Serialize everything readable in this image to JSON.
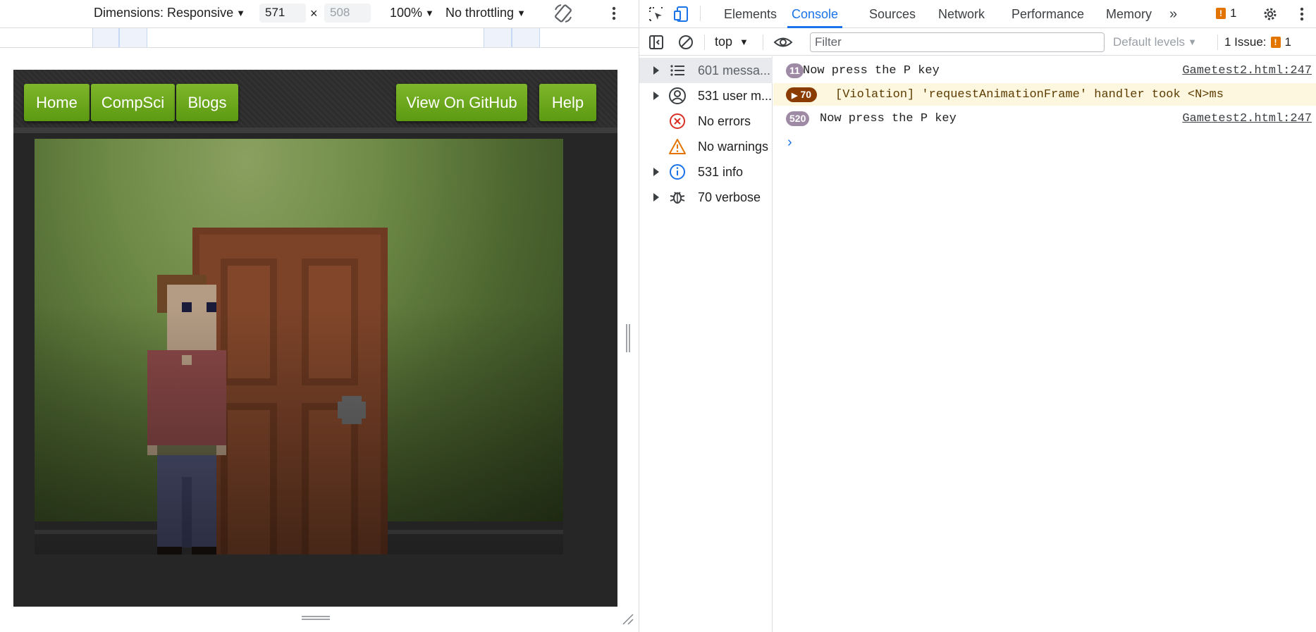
{
  "device_toolbar": {
    "dimensions_label": "Dimensions: Responsive",
    "width_value": "571",
    "times_symbol": "×",
    "height_placeholder": "508",
    "zoom": "100%",
    "throttling": "No throttling"
  },
  "page": {
    "nav": {
      "home": "Home",
      "compsci": "CompSci",
      "blogs": "Blogs",
      "github": "View On GitHub",
      "help": "Help"
    }
  },
  "devtools": {
    "tabs": [
      "Elements",
      "Console",
      "Sources",
      "Network",
      "Performance",
      "Memory"
    ],
    "active_tab": "Console",
    "issues_badge_count": "1",
    "console_toolbar": {
      "context": "top",
      "filter_placeholder": "Filter",
      "levels": "Default levels",
      "issue_label": "1 Issue:",
      "issue_count": "1"
    },
    "sidebar": [
      {
        "label": "601 messa...",
        "icon": "list-icon",
        "expandable": true,
        "selected": true
      },
      {
        "label": "531 user m...",
        "icon": "user-icon",
        "expandable": true,
        "selected": false
      },
      {
        "label": "No errors",
        "icon": "error-icon",
        "expandable": false,
        "selected": false
      },
      {
        "label": "No warnings",
        "icon": "warning-icon",
        "expandable": false,
        "selected": false
      },
      {
        "label": "531 info",
        "icon": "info-icon",
        "expandable": true,
        "selected": false
      },
      {
        "label": "70 verbose",
        "icon": "bug-icon",
        "expandable": true,
        "selected": false
      }
    ],
    "messages": [
      {
        "count": "11",
        "text": "Now press the P key",
        "source": "Gametest2.html:247",
        "type": "log"
      },
      {
        "count": "70",
        "text": "[Violation] 'requestAnimationFrame' handler took <N>ms",
        "source": "",
        "type": "violation"
      },
      {
        "count": "520",
        "text": "Now press the P key",
        "source": "Gametest2.html:247",
        "type": "log"
      }
    ]
  },
  "colors": {
    "accent": "#1a73e8",
    "nav_button": "#6aa61c",
    "violation_bg": "#fef7e0",
    "warning_badge": "#e37400"
  }
}
